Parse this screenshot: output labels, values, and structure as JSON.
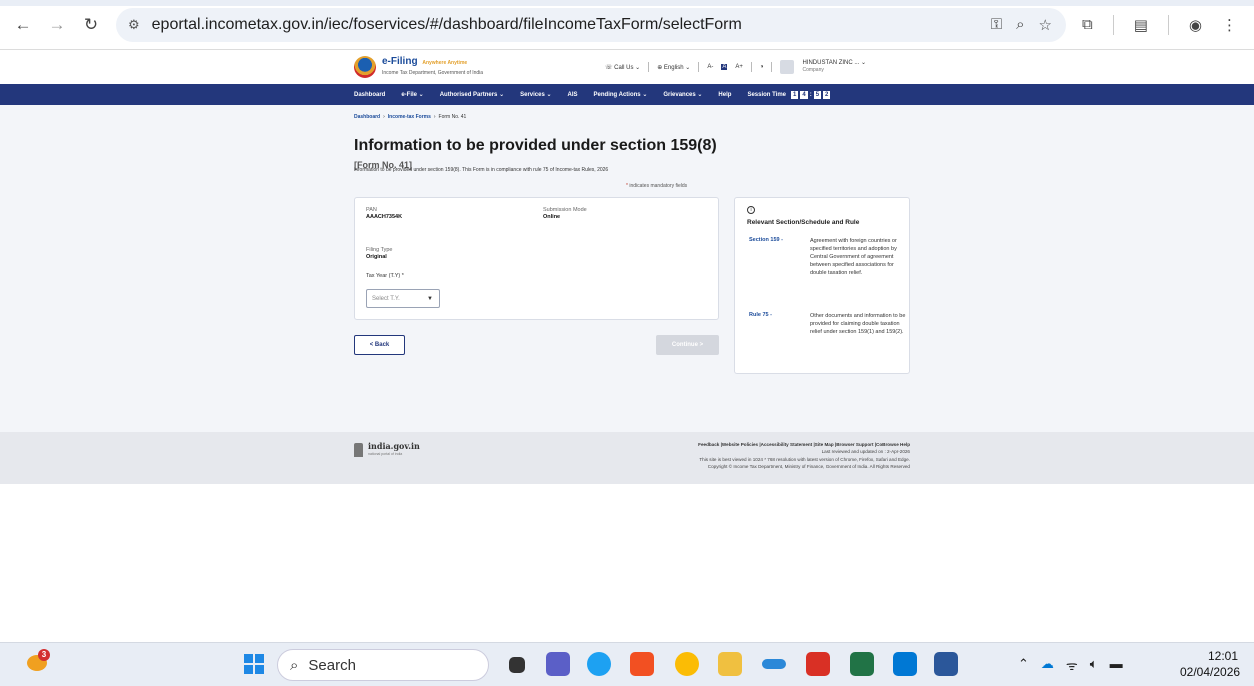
{
  "browser": {
    "url": "eportal.incometax.gov.in/iec/foservices/#/dashboard/fileIncomeTaxForm/selectForm"
  },
  "header": {
    "logo_title": "e-Filing",
    "logo_tagline": "Anywhere Anytime",
    "logo_subtitle": "Income Tax Department, Government of India",
    "call_us": "Call Us",
    "language": "English",
    "font_controls": [
      "A-",
      "A",
      "A+"
    ],
    "user_name": "HINDUSTAN ZINC ...",
    "user_type": "Company"
  },
  "nav": {
    "items": [
      "Dashboard",
      "e-File",
      "Authorised Partners",
      "Services",
      "AIS",
      "Pending Actions",
      "Grievances",
      "Help"
    ],
    "session_label": "Session Time",
    "session_digits": [
      "1",
      "4",
      "5",
      "2"
    ]
  },
  "breadcrumb": {
    "items": [
      "Dashboard",
      "Income-tax Forms",
      "Form No. 41"
    ]
  },
  "page": {
    "title": "Information to be provided under section 159(8)",
    "form_no": "[Form No. 41]",
    "subtitle": "Information to be provided under section 159(8). This Form is in compliance with rule 75 of Income-tax Rules, 2026",
    "mandatory_note": "indicates mandatory fields"
  },
  "form": {
    "pan_label": "PAN",
    "pan_value": "AAACH7354K",
    "submission_label": "Submission Mode",
    "submission_value": "Online",
    "filing_label": "Filing Type",
    "filing_value": "Original",
    "tax_year_label": "Tax Year (T.Y) *",
    "tax_year_placeholder": "Select T.Y.",
    "back_label": "< Back",
    "continue_label": "Continue >"
  },
  "side_panel": {
    "title": "Relevant Section/Schedule and Rule",
    "rows": [
      {
        "link": "Section 159 -",
        "desc": "Agreement with foreign countries or specified territories and adoption by Central Government of agreement between specified associations for double taxation relief."
      },
      {
        "link": "Rule 75 -",
        "desc": "Other documents and information to be provided for claiming double taxation relief under section 159(1) and 159(2)."
      }
    ]
  },
  "footer": {
    "india_logo": "india.gov.in",
    "india_tagline": "national portal of india",
    "links": "Feedback |Website Policies |Accessibility Statement |Site Map |Browser Support |CoBrowse Help",
    "updated": "Last reviewed and updated on : 2-Apr-2026",
    "browser_note": "This site is best viewed in 1024 * 768 resolution with latest version of Chrome, Firefox, Safari and Edge.",
    "copyright": "Copyright © Income Tax Department, Ministry of Finance, Government of India. All Rights Reserved"
  },
  "taskbar": {
    "weather_badge": "3",
    "search_label": "Search",
    "time": "12:01",
    "date": "02/04/2026"
  },
  "colors": {
    "nav_bg": "#23377c",
    "link": "#1b4b9a",
    "page_bg": "#f3f5f9"
  }
}
